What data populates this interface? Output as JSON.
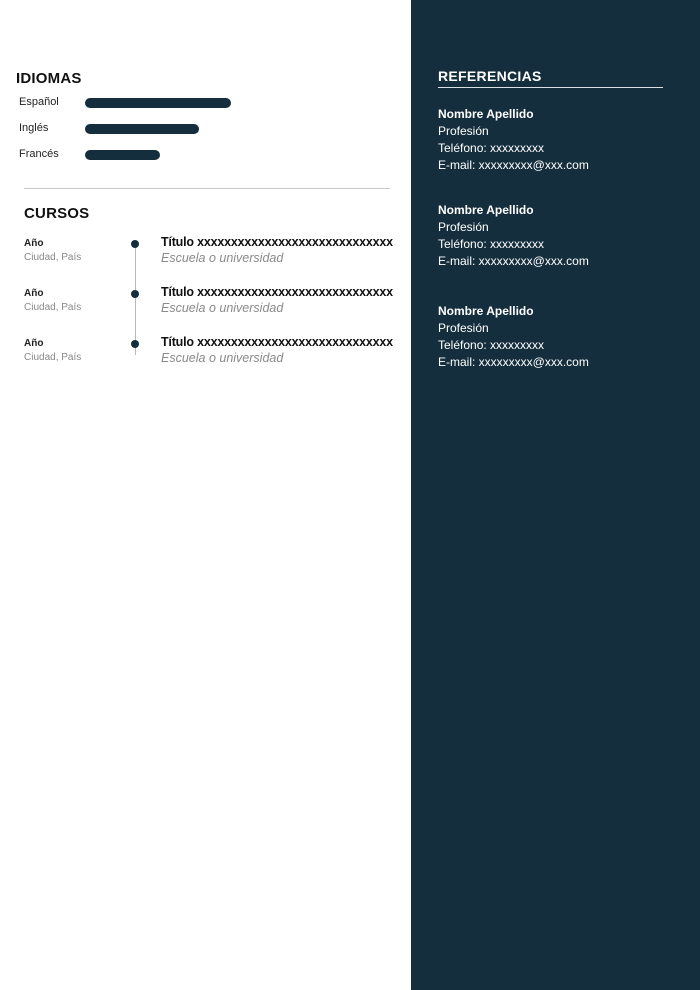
{
  "languages": {
    "title": "IDIOMAS",
    "items": [
      {
        "name": "Español",
        "level": 0.86
      },
      {
        "name": "Inglés",
        "level": 0.67
      },
      {
        "name": "Francés",
        "level": 0.44
      }
    ]
  },
  "courses": {
    "title": "CURSOS",
    "items": [
      {
        "year": "Año",
        "place": "Ciudad, País",
        "title": "Título xxxxxxxxxxxxxxxxxxxxxxxxxxxxx",
        "school": "Escuela o universidad"
      },
      {
        "year": "Año",
        "place": "Ciudad, País",
        "title": "Título xxxxxxxxxxxxxxxxxxxxxxxxxxxxx",
        "school": "Escuela o universidad"
      },
      {
        "year": "Año",
        "place": "Ciudad, País",
        "title": "Título xxxxxxxxxxxxxxxxxxxxxxxxxxxxx",
        "school": "Escuela o universidad"
      }
    ]
  },
  "references": {
    "title": "REFERENCIAS",
    "items": [
      {
        "name": "Nombre Apellido",
        "profession": "Profesión",
        "phone": "Teléfono: xxxxxxxxx",
        "email": "E-mail: xxxxxxxxx@xxx.com"
      },
      {
        "name": "Nombre Apellido",
        "profession": "Profesión",
        "phone": "Teléfono: xxxxxxxxx",
        "email": "E-mail: xxxxxxxxx@xxx.com"
      },
      {
        "name": "Nombre Apellido",
        "profession": "Profesión",
        "phone": "Teléfono: xxxxxxxxx",
        "email": "E-mail: xxxxxxxxx@xxx.com"
      }
    ]
  },
  "colors": {
    "accent": "#152e3d",
    "sidebar_bg": "#152e3d",
    "muted_text": "#8a8a8a"
  }
}
